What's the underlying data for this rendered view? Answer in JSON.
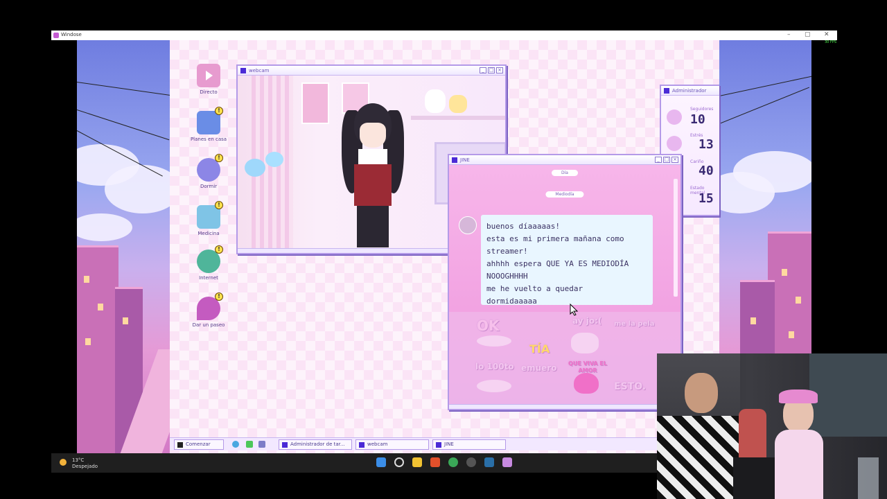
{
  "os_window": {
    "title": "Windose",
    "controls": [
      "–",
      "▢",
      "✕"
    ],
    "fps": "30 FPS"
  },
  "desktop_icons": [
    {
      "label": "Directo",
      "icon": "play-icon",
      "color": "#e79bcf",
      "badge": ""
    },
    {
      "label": "Planes en casa",
      "icon": "plan-icon",
      "color": "#6a8de6",
      "badge": "!"
    },
    {
      "label": "Dormir",
      "icon": "clock-icon",
      "color": "#8c86e6",
      "badge": "!"
    },
    {
      "label": "Medicina",
      "icon": "pill-icon",
      "color": "#7fc4e6",
      "badge": "!"
    },
    {
      "label": "Internet",
      "icon": "globe-icon",
      "color": "#4fb59a",
      "badge": "!"
    },
    {
      "label": "Dar un paseo",
      "icon": "map-pin-icon",
      "color": "#c45bc0",
      "badge": "!"
    }
  ],
  "webcam_window": {
    "title": "webcam"
  },
  "chat_window": {
    "title": "JINE",
    "day_label": "Día",
    "time_label": "Mediodía",
    "message_lines": [
      "buenos díaaaaas!",
      "esta es mi primera mañana como",
      "streamer!",
      "ahhhh espera QUE YA ES MEDIODÍA",
      "NOOOGHHHH",
      "me he vuelto a quedar",
      "dormidaaaaa"
    ],
    "stamps": [
      {
        "text": "OK",
        "color": "#f7c0ec"
      },
      {
        "text": "TÍA",
        "color": "#ffd76a"
      },
      {
        "text": "ay jo:(",
        "color": "#f4c6f0"
      },
      {
        "text": "me la pela",
        "color": "#f4c6f0"
      },
      {
        "text": "lo 100to",
        "color": "#f4c6f0"
      },
      {
        "text": "emuero",
        "color": "#f4c6f0"
      },
      {
        "text": "QUE VIVA EL AMOR",
        "color": "#f070c8"
      },
      {
        "text": "ESTO.",
        "color": "#f4c6f0"
      }
    ]
  },
  "admin_window": {
    "title": "Administrador",
    "stats": [
      {
        "label": "Seguidores",
        "value": "10"
      },
      {
        "label": "Estrés",
        "value": "13"
      },
      {
        "label": "Cariño",
        "value": "40"
      },
      {
        "label": "Estado mental",
        "value": "15"
      }
    ]
  },
  "game_taskbar": {
    "start": "Comenzar",
    "tasks": [
      "Administrador de tar...",
      "webcam",
      "JINE"
    ]
  },
  "windows_taskbar": {
    "weather_temp": "13°C",
    "weather_desc": "Despejado"
  }
}
